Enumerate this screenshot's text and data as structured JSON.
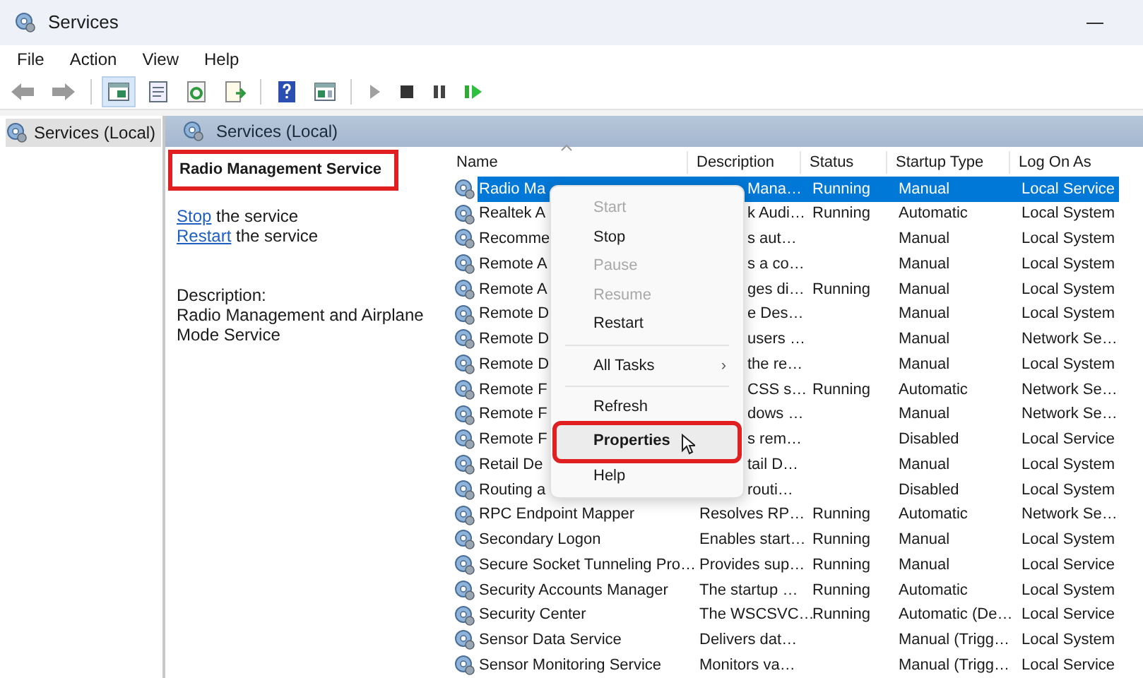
{
  "window": {
    "title": "Services"
  },
  "menu_bar": [
    "File",
    "Action",
    "View",
    "Help"
  ],
  "tree": {
    "items": [
      {
        "label": "Services (Local)",
        "selected": true
      }
    ]
  },
  "pane_header": "Services (Local)",
  "details": {
    "title": "Radio Management Service",
    "annotated": true,
    "actions": [
      {
        "link": "Stop",
        "text": "the service"
      },
      {
        "link": "Restart",
        "text": "the service"
      }
    ],
    "description_label": "Description:",
    "description": "Radio Management and Airplane Mode Service"
  },
  "table": {
    "columns": [
      "Name",
      "Description",
      "Status",
      "Startup Type",
      "Log On As"
    ],
    "rows": [
      {
        "name": "Radio Ma",
        "description": "Mana…",
        "status": "Running",
        "startup": "Manual",
        "logon": "Local Service",
        "selected": true
      },
      {
        "name": "Realtek A",
        "description": "k Audi…",
        "status": "Running",
        "startup": "Automatic",
        "logon": "Local System",
        "selected": false
      },
      {
        "name": "Recomme",
        "description": "s aut…",
        "status": "",
        "startup": "Manual",
        "logon": "Local System",
        "selected": false
      },
      {
        "name": "Remote A",
        "description": "s a co…",
        "status": "",
        "startup": "Manual",
        "logon": "Local System",
        "selected": false
      },
      {
        "name": "Remote A",
        "description": "ges di…",
        "status": "Running",
        "startup": "Manual",
        "logon": "Local System",
        "selected": false
      },
      {
        "name": "Remote D",
        "description": "e Des…",
        "status": "",
        "startup": "Manual",
        "logon": "Local System",
        "selected": false
      },
      {
        "name": "Remote D",
        "description": "users …",
        "status": "",
        "startup": "Manual",
        "logon": "Network Se…",
        "selected": false
      },
      {
        "name": "Remote D",
        "description": "the re…",
        "status": "",
        "startup": "Manual",
        "logon": "Local System",
        "selected": false
      },
      {
        "name": "Remote F",
        "description": "CSS s…",
        "status": "Running",
        "startup": "Automatic",
        "logon": "Network Se…",
        "selected": false
      },
      {
        "name": "Remote F",
        "description": "dows …",
        "status": "",
        "startup": "Manual",
        "logon": "Network Se…",
        "selected": false
      },
      {
        "name": "Remote F",
        "description": "s rem…",
        "status": "",
        "startup": "Disabled",
        "logon": "Local Service",
        "selected": false
      },
      {
        "name": "Retail De",
        "description": "tail D…",
        "status": "",
        "startup": "Manual",
        "logon": "Local System",
        "selected": false
      },
      {
        "name": "Routing a",
        "description": "routi…",
        "status": "",
        "startup": "Disabled",
        "logon": "Local System",
        "selected": false
      },
      {
        "name": "RPC Endpoint Mapper",
        "description": "Resolves RP…",
        "status": "Running",
        "startup": "Automatic",
        "logon": "Network Se…",
        "selected": false
      },
      {
        "name": "Secondary Logon",
        "description": "Enables start…",
        "status": "Running",
        "startup": "Manual",
        "logon": "Local System",
        "selected": false
      },
      {
        "name": "Secure Socket Tunneling Pro…",
        "description": "Provides sup…",
        "status": "Running",
        "startup": "Manual",
        "logon": "Local Service",
        "selected": false
      },
      {
        "name": "Security Accounts Manager",
        "description": "The startup …",
        "status": "Running",
        "startup": "Automatic",
        "logon": "Local System",
        "selected": false
      },
      {
        "name": "Security Center",
        "description": "The WSCSVC…",
        "status": "Running",
        "startup": "Automatic (De…",
        "logon": "Local Service",
        "selected": false
      },
      {
        "name": "Sensor Data Service",
        "description": "Delivers dat…",
        "status": "",
        "startup": "Manual (Trigg…",
        "logon": "Local System",
        "selected": false
      },
      {
        "name": "Sensor Monitoring Service",
        "description": "Monitors va…",
        "status": "",
        "startup": "Manual (Trigg…",
        "logon": "Local Service",
        "selected": false
      }
    ]
  },
  "context_menu": [
    {
      "kind": "item",
      "label": "Start",
      "disabled": true
    },
    {
      "kind": "item",
      "label": "Stop",
      "disabled": false
    },
    {
      "kind": "item",
      "label": "Pause",
      "disabled": true
    },
    {
      "kind": "item",
      "label": "Resume",
      "disabled": true
    },
    {
      "kind": "item",
      "label": "Restart",
      "disabled": false
    },
    {
      "kind": "separator"
    },
    {
      "kind": "submenu",
      "label": "All Tasks",
      "arrow": "›",
      "disabled": false
    },
    {
      "kind": "separator"
    },
    {
      "kind": "item",
      "label": "Refresh",
      "disabled": false
    },
    {
      "kind": "item",
      "label": "Properties",
      "disabled": false,
      "default": true,
      "hovered": true,
      "annotated": true
    },
    {
      "kind": "item",
      "label": "Help",
      "disabled": false
    }
  ]
}
